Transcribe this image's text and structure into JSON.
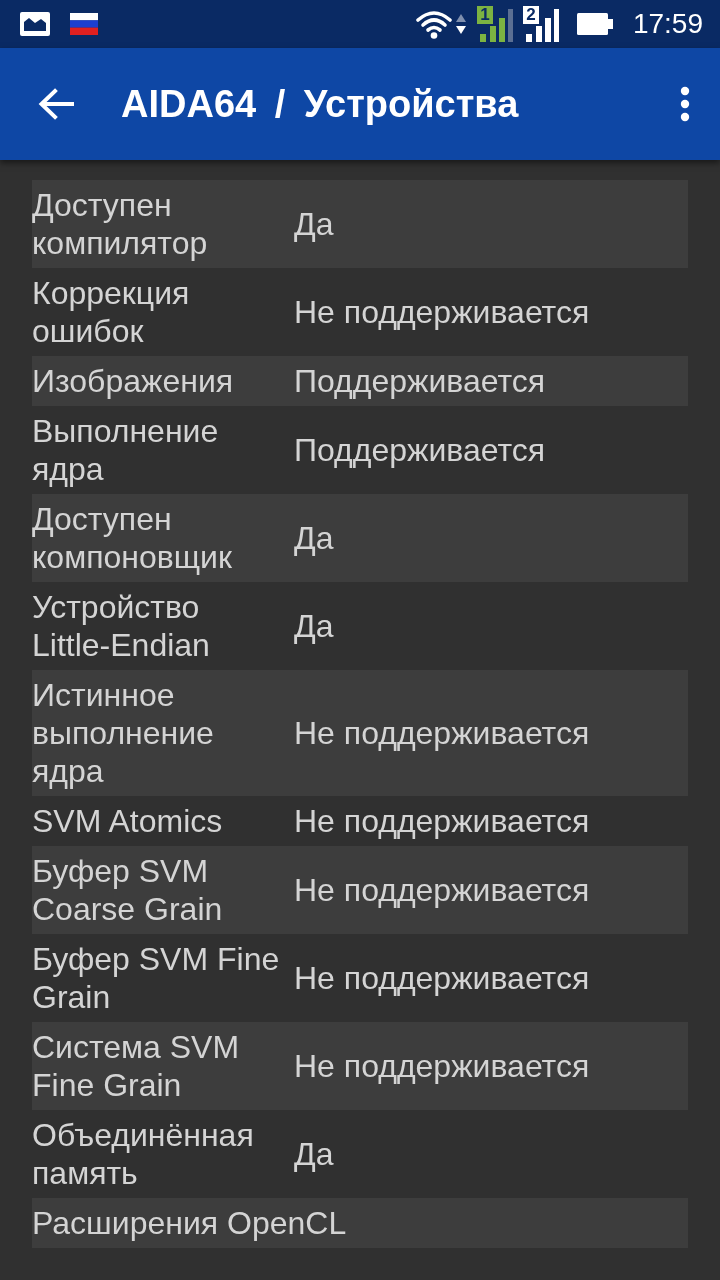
{
  "status_bar": {
    "sims": [
      {
        "label": "1",
        "color": "#7cb342"
      },
      {
        "label": "2",
        "color": "#ffffff"
      }
    ],
    "time": "17:59"
  },
  "app_bar": {
    "title": "AIDA64 / Устройства"
  },
  "rows": [
    {
      "label": "Доступен компилятор",
      "value": "Да"
    },
    {
      "label": "Коррекция ошибок",
      "value": "Не поддерживается"
    },
    {
      "label": "Изображения",
      "value": "Поддерживается"
    },
    {
      "label": "Выполнение ядра",
      "value": "Поддерживается"
    },
    {
      "label": "Доступен компоновщик",
      "value": "Да"
    },
    {
      "label": "Устройство Little-Endian",
      "value": "Да"
    },
    {
      "label": "Истинное выполнение ядра",
      "value": "Не поддерживается"
    },
    {
      "label": "SVM Atomics",
      "value": "Не поддерживается"
    },
    {
      "label": "Буфер SVM Coarse Grain",
      "value": "Не поддерживается"
    },
    {
      "label": "Буфер SVM Fine Grain",
      "value": "Не поддерживается"
    },
    {
      "label": "Система SVM Fine Grain",
      "value": "Не поддерживается"
    },
    {
      "label": "Объединённая память",
      "value": "Да"
    },
    {
      "label": "Расширения OpenCL"
    }
  ]
}
